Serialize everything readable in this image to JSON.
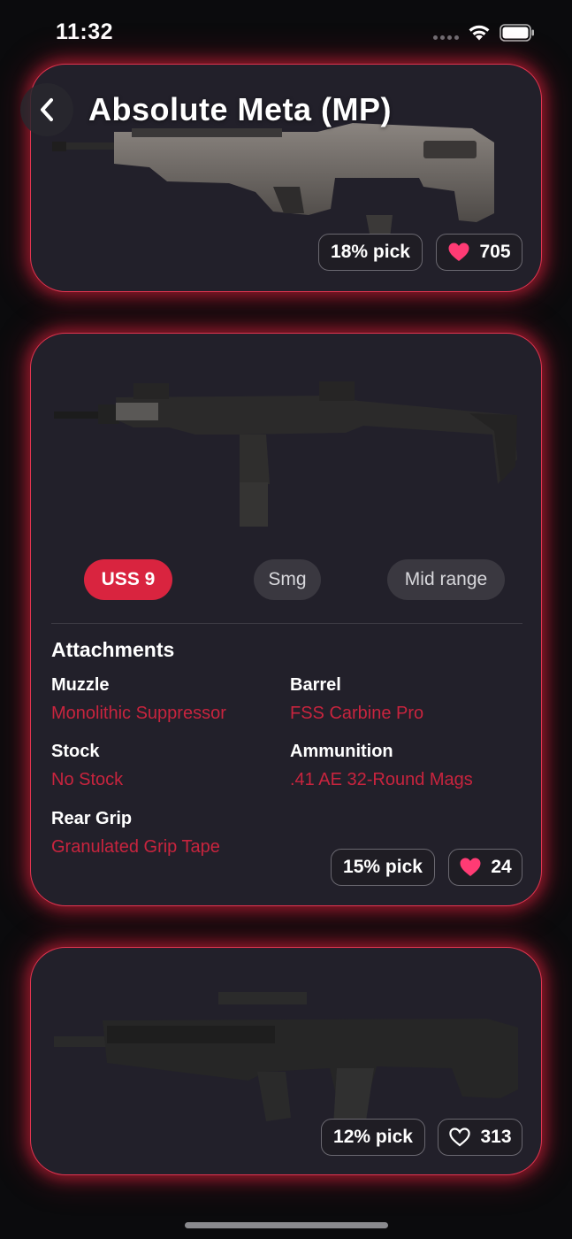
{
  "status_bar": {
    "time": "11:32"
  },
  "header": {
    "title": "Absolute Meta (MP)",
    "back_icon": "chevron-left-icon"
  },
  "colors": {
    "accent": "#d9243f",
    "attachment_value": "#c8243e",
    "card_background": "#22202a",
    "heart_filled": "#ff3b74"
  },
  "loadouts": [
    {
      "pick_rate": "18% pick",
      "likes": "705",
      "liked": true
    },
    {
      "weapon": "USS 9",
      "category": "Smg",
      "range": "Mid range",
      "attachments_title": "Attachments",
      "attachments": [
        {
          "slot": "Muzzle",
          "name": "Monolithic Suppressor"
        },
        {
          "slot": "Barrel",
          "name": "FSS Carbine Pro"
        },
        {
          "slot": "Stock",
          "name": "No Stock"
        },
        {
          "slot": "Ammunition",
          "name": ".41 AE 32-Round Mags"
        },
        {
          "slot": "Rear Grip",
          "name": "Granulated Grip Tape"
        }
      ],
      "pick_rate": "15% pick",
      "likes": "24",
      "liked": true
    },
    {
      "pick_rate": "12% pick",
      "likes": "313",
      "liked": false
    }
  ]
}
